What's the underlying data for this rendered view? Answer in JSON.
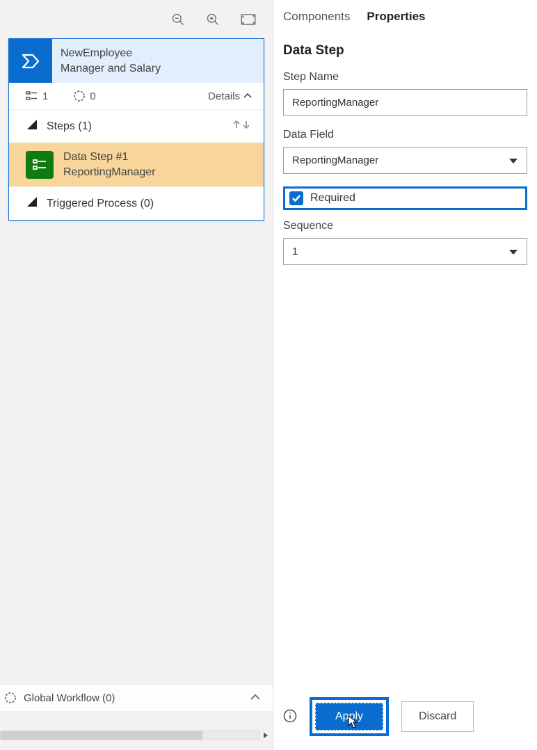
{
  "tabs": {
    "components": "Components",
    "properties": "Properties"
  },
  "panel": {
    "title": "Data Step",
    "stepNameLabel": "Step Name",
    "stepNameValue": "ReportingManager",
    "dataFieldLabel": "Data Field",
    "dataFieldValue": "ReportingManager",
    "requiredLabel": "Required",
    "sequenceLabel": "Sequence",
    "sequenceValue": "1",
    "applyLabel": "Apply",
    "discardLabel": "Discard"
  },
  "card": {
    "titleLine1": "NewEmployee",
    "titleLine2": "Manager and Salary",
    "stepsCount": "1",
    "processCount": "0",
    "detailsLabel": "Details",
    "stepsHeader": "Steps (1)",
    "dataStepTitle": "Data Step #1",
    "dataStepSubtitle": "ReportingManager",
    "triggeredHeader": "Triggered Process (0)"
  },
  "global": {
    "label": "Global Workflow (0)"
  }
}
